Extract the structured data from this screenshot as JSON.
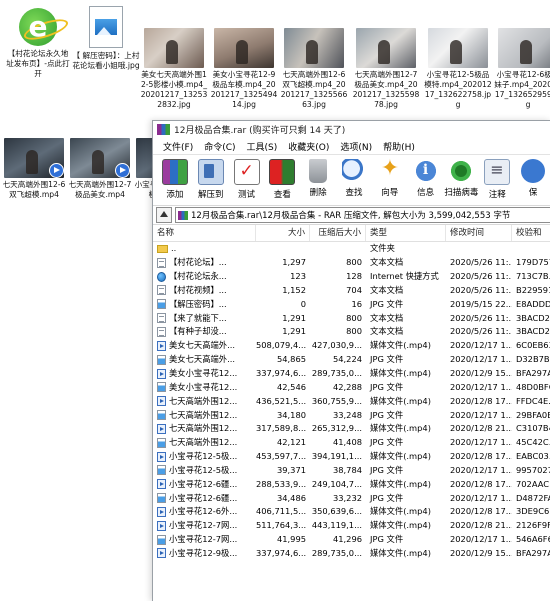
{
  "desktop": {
    "icons": [
      {
        "kind": "ie",
        "caption": "【村花论坛永久地址发布页】-点此打开"
      },
      {
        "kind": "jpg",
        "caption": "【 解压密码】：上村花论坛看小姐哦.jpg"
      },
      {
        "kind": "thumb",
        "thumb": "bed1",
        "caption": "美女七天高端外围12-5影楼小模.mp4_20201217_132532832.jpg"
      },
      {
        "kind": "thumb",
        "thumb": "bed2",
        "caption": "美女小宝寻花12-9极品车模.mp4_20201217_132549414.jpg"
      },
      {
        "kind": "thumb",
        "thumb": "room1",
        "caption": "七天高端外围12-6双飞超模.mp4_20201217_132556663.jpg"
      },
      {
        "kind": "thumb",
        "thumb": "room2",
        "caption": "七天高端外围12-7极品美女.mp4_20201217_132559878.jpg"
      },
      {
        "kind": "thumb",
        "thumb": "room3",
        "caption": "小宝寻花12-5极品模特.mp4_20201217_132622758.jpg"
      },
      {
        "kind": "thumb",
        "thumb": "room4",
        "caption": "小宝寻花12-6极气妹子.mp4_20201217_132652959.jpg"
      },
      {
        "kind": "video",
        "thumb": "dark1",
        "caption": "七天高端外围12-6双飞超模.mp4"
      },
      {
        "kind": "video",
        "thumb": "dark2",
        "caption": "七天高端外围12-7极品美女.mp4"
      },
      {
        "kind": "video",
        "thumb": "dark1",
        "caption": "小宝寻花12-5极品模特.mp4"
      }
    ]
  },
  "window": {
    "title": "12月极品合集.rar (购买许可只剩 14 天了)",
    "menu": [
      "文件(F)",
      "命令(C)",
      "工具(S)",
      "收藏夹(O)",
      "选项(N)",
      "帮助(H)"
    ],
    "toolbar": [
      {
        "icon": "add",
        "label": "添加"
      },
      {
        "icon": "extract",
        "label": "解压到"
      },
      {
        "icon": "test",
        "label": "测试"
      },
      {
        "icon": "view",
        "label": "查看"
      },
      {
        "icon": "del",
        "label": "删除"
      },
      {
        "icon": "find",
        "label": "查找"
      },
      {
        "icon": "wiz",
        "label": "向导"
      },
      {
        "icon": "info",
        "label": "信息"
      },
      {
        "icon": "scan",
        "label": "扫描病毒"
      },
      {
        "icon": "comment",
        "label": "注释"
      },
      {
        "icon": "sfx",
        "label": "保"
      }
    ],
    "address": "12月极品合集.rar\\12月极品合集 - RAR 压缩文件, 解包大小为 3,599,042,553 字节",
    "columns": {
      "name": "名称",
      "size": "大小",
      "packed": "压缩后大小",
      "type": "类型",
      "modified": "修改时间",
      "crc": "校验和"
    },
    "files": [
      {
        "icon": "folder",
        "name": "..",
        "size": "",
        "packed": "",
        "type": "文件夹",
        "modified": "",
        "crc": ""
      },
      {
        "icon": "text",
        "name": "【村花论坛】...",
        "size": "1,297",
        "packed": "800",
        "type": "文本文档",
        "modified": "2020/5/26 11:...",
        "crc": "179D7573"
      },
      {
        "icon": "globe",
        "name": "【村花论坛永...",
        "size": "123",
        "packed": "128",
        "type": "Internet 快捷方式",
        "modified": "2020/5/26 11:...",
        "crc": "713C7B..."
      },
      {
        "icon": "text",
        "name": "【村花视频】...",
        "size": "1,152",
        "packed": "704",
        "type": "文本文档",
        "modified": "2020/5/26 11:...",
        "crc": "B229591F"
      },
      {
        "icon": "image",
        "name": "【解压密码】...",
        "size": "0",
        "packed": "16",
        "type": "JPG 文件",
        "modified": "2019/5/15 22...",
        "crc": "E8ADDD..."
      },
      {
        "icon": "text",
        "name": "【来了就能下...",
        "size": "1,291",
        "packed": "800",
        "type": "文本文档",
        "modified": "2020/5/26 11:...",
        "crc": "3BACD2..."
      },
      {
        "icon": "text",
        "name": "【有种子却没...",
        "size": "1,291",
        "packed": "800",
        "type": "文本文档",
        "modified": "2020/5/26 11:...",
        "crc": "3BACD2..."
      },
      {
        "icon": "video",
        "name": "美女七天高端外...",
        "size": "508,079,4...",
        "packed": "427,030,9...",
        "type": "媒体文件(.mp4)",
        "modified": "2020/12/17 1...",
        "crc": "6C0EB63F"
      },
      {
        "icon": "image",
        "name": "美女七天高端外...",
        "size": "54,865",
        "packed": "54,224",
        "type": "JPG 文件",
        "modified": "2020/12/17 1...",
        "crc": "D32B7B..."
      },
      {
        "icon": "video",
        "name": "美女小宝寻花12...",
        "size": "337,974,6...",
        "packed": "289,735,0...",
        "type": "媒体文件(.mp4)",
        "modified": "2020/12/9 15...",
        "crc": "BFA297AF"
      },
      {
        "icon": "image",
        "name": "美女小宝寻花12...",
        "size": "42,546",
        "packed": "42,288",
        "type": "JPG 文件",
        "modified": "2020/12/17 1...",
        "crc": "48D0BFC0"
      },
      {
        "icon": "video",
        "name": "七天高端外围12...",
        "size": "436,521,5...",
        "packed": "360,755,9...",
        "type": "媒体文件(.mp4)",
        "modified": "2020/12/8 17...",
        "crc": "FFDC4E..."
      },
      {
        "icon": "image",
        "name": "七天高端外围12...",
        "size": "34,180",
        "packed": "33,248",
        "type": "JPG 文件",
        "modified": "2020/12/17 1...",
        "crc": "29BFA0E8"
      },
      {
        "icon": "video",
        "name": "七天高端外围12...",
        "size": "317,589,8...",
        "packed": "265,312,9...",
        "type": "媒体文件(.mp4)",
        "modified": "2020/12/8 21...",
        "crc": "C3107B46"
      },
      {
        "icon": "image",
        "name": "七天高端外围12...",
        "size": "42,121",
        "packed": "41,408",
        "type": "JPG 文件",
        "modified": "2020/12/17 1...",
        "crc": "45C42C..."
      },
      {
        "icon": "video",
        "name": "小宝寻花12-5极...",
        "size": "453,597,7...",
        "packed": "394,191,1...",
        "type": "媒体文件(.mp4)",
        "modified": "2020/12/8 17...",
        "crc": "EABC03..."
      },
      {
        "icon": "image",
        "name": "小宝寻花12-5极...",
        "size": "39,371",
        "packed": "38,784",
        "type": "JPG 文件",
        "modified": "2020/12/17 1...",
        "crc": "99570277"
      },
      {
        "icon": "video",
        "name": "小宝寻花12-6疆...",
        "size": "288,533,9...",
        "packed": "249,104,7...",
        "type": "媒体文件(.mp4)",
        "modified": "2020/12/8 17...",
        "crc": "702AAC..."
      },
      {
        "icon": "image",
        "name": "小宝寻花12-6疆...",
        "size": "34,486",
        "packed": "33,232",
        "type": "JPG 文件",
        "modified": "2020/12/17 1...",
        "crc": "D4872FA1"
      },
      {
        "icon": "video",
        "name": "小宝寻花12-6外...",
        "size": "406,711,5...",
        "packed": "350,639,6...",
        "type": "媒体文件(.mp4)",
        "modified": "2020/12/8 17...",
        "crc": "3DE9C6..."
      },
      {
        "icon": "video",
        "name": "小宝寻花12-7网...",
        "size": "511,764,3...",
        "packed": "443,119,1...",
        "type": "媒体文件(.mp4)",
        "modified": "2020/12/8 21...",
        "crc": "2126F9F9"
      },
      {
        "icon": "image",
        "name": "小宝寻花12-7网...",
        "size": "41,995",
        "packed": "41,296",
        "type": "JPG 文件",
        "modified": "2020/12/17 1...",
        "crc": "546A6F64"
      },
      {
        "icon": "video",
        "name": "小宝寻花12-9极...",
        "size": "337,974,6...",
        "packed": "289,735,0...",
        "type": "媒体文件(.mp4)",
        "modified": "2020/12/9 15...",
        "crc": "BFA297AF"
      }
    ]
  }
}
